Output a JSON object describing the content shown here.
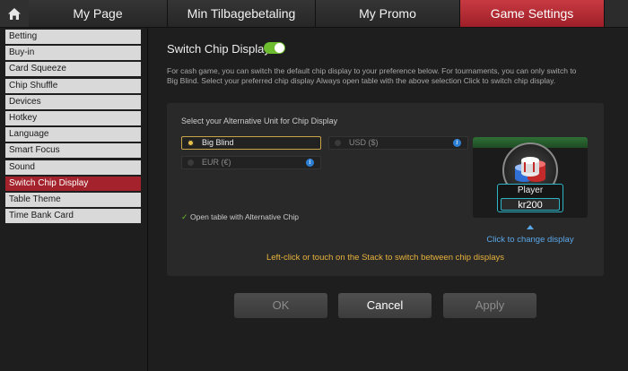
{
  "tabs": [
    {
      "label": "My Page"
    },
    {
      "label": "Min Tilbagebetaling"
    },
    {
      "label": "My Promo"
    },
    {
      "label": "Game Settings"
    }
  ],
  "active_tab": "Game Settings",
  "sidebar": {
    "items": [
      {
        "label": "Betting"
      },
      {
        "label": "Buy-in"
      },
      {
        "label": "Card Squeeze"
      },
      {
        "label": "Chip Shuffle"
      },
      {
        "label": "Devices"
      },
      {
        "label": "Hotkey"
      },
      {
        "label": "Language"
      },
      {
        "label": "Smart Focus"
      },
      {
        "label": "Sound"
      },
      {
        "label": "Switch Chip Display"
      },
      {
        "label": "Table Theme"
      },
      {
        "label": "Time Bank Card"
      }
    ],
    "active": "Switch Chip Display"
  },
  "main": {
    "title": "Switch Chip Display",
    "toggle_on": true,
    "description": "For cash game, you can switch the default chip display to your preference below. For tournaments, you can only switch to Big Blind. Select your preferred chip display Always open table with the above selection Click to switch chip display."
  },
  "panel": {
    "title": "Select your Alternative Unit for Chip Display",
    "options": [
      {
        "label": "Big Blind",
        "selected": true
      },
      {
        "label": "USD ($)",
        "selected": false
      },
      {
        "label": "EUR (€)",
        "selected": false
      }
    ],
    "info_glyph": "i",
    "checkbox_label": "Open table with Alternative Chip",
    "checkbox_checked": true,
    "preview": {
      "player_name": "Player",
      "amount": "kr200"
    },
    "change_link": "Click to change display",
    "hint": "Left-click or touch on the Stack to switch between chip displays"
  },
  "buttons": {
    "ok": "OK",
    "cancel": "Cancel",
    "apply": "Apply"
  },
  "colors": {
    "accent_red": "#a3222b",
    "toggle_green": "#6dbb2f",
    "link_blue": "#5aa7e8",
    "hint_gold": "#e7b23c",
    "selected_border": "#c8a648"
  }
}
